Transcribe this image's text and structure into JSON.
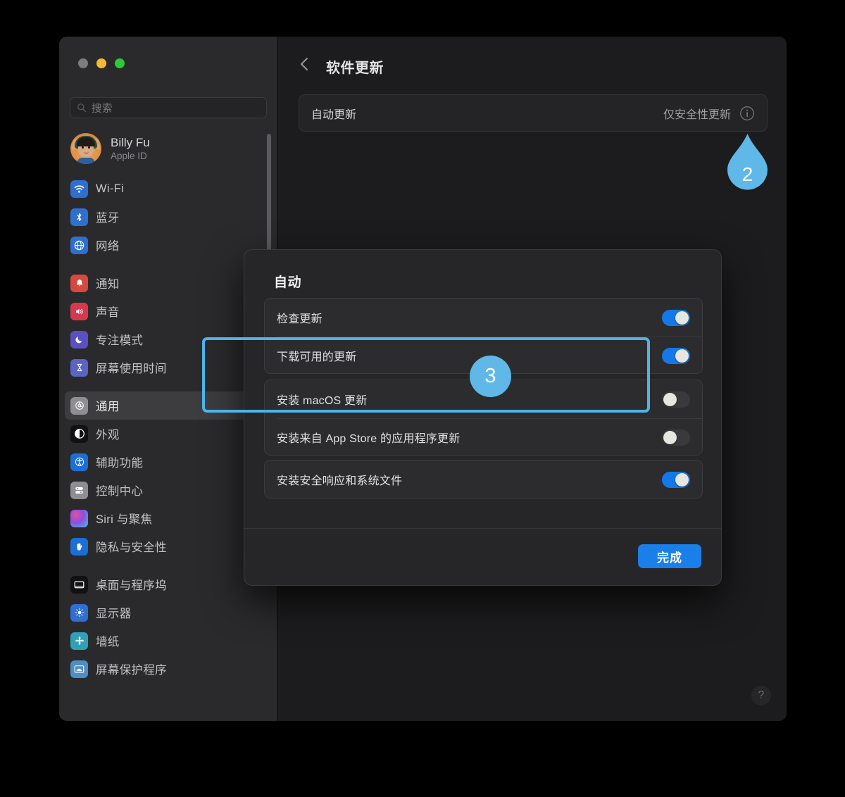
{
  "window": {
    "traffic_lights": [
      "close",
      "minimize",
      "maximize"
    ]
  },
  "sidebar": {
    "search": {
      "placeholder": "搜索",
      "icon": "search-icon"
    },
    "account": {
      "name": "Billy Fu",
      "subtitle": "Apple ID",
      "avatar": "memoji-avatar"
    },
    "groups": [
      {
        "items": [
          {
            "label": "Wi-Fi",
            "icon": "wifi-icon",
            "selected": false
          },
          {
            "label": "蓝牙",
            "icon": "bluetooth-icon",
            "selected": false
          },
          {
            "label": "网络",
            "icon": "network-icon",
            "selected": false
          }
        ]
      },
      {
        "items": [
          {
            "label": "通知",
            "icon": "bell-icon",
            "selected": false
          },
          {
            "label": "声音",
            "icon": "speaker-icon",
            "selected": false
          },
          {
            "label": "专注模式",
            "icon": "moon-icon",
            "selected": false
          },
          {
            "label": "屏幕使用时间",
            "icon": "hourglass-icon",
            "selected": false
          }
        ]
      },
      {
        "items": [
          {
            "label": "通用",
            "icon": "gear-icon",
            "selected": true
          },
          {
            "label": "外观",
            "icon": "appearance-icon",
            "selected": false
          },
          {
            "label": "辅助功能",
            "icon": "accessibility-icon",
            "selected": false
          },
          {
            "label": "控制中心",
            "icon": "control-center-icon",
            "selected": false
          },
          {
            "label": "Siri 与聚焦",
            "icon": "siri-icon",
            "selected": false
          },
          {
            "label": "隐私与安全性",
            "icon": "hand-privacy-icon",
            "selected": false
          }
        ]
      },
      {
        "items": [
          {
            "label": "桌面与程序坞",
            "icon": "desktop-dock-icon",
            "selected": false
          },
          {
            "label": "显示器",
            "icon": "display-icon",
            "selected": false
          },
          {
            "label": "墙纸",
            "icon": "wallpaper-icon",
            "selected": false
          },
          {
            "label": "屏幕保护程序",
            "icon": "screensaver-icon",
            "selected": false
          }
        ]
      }
    ]
  },
  "content": {
    "back_icon": "chevron-left-icon",
    "title": "软件更新",
    "auto_update_row": {
      "label": "自动更新",
      "value": "仅安全性更新",
      "info_icon": "info-circle-icon"
    },
    "help_button": {
      "label": "?",
      "icon": "help-icon"
    }
  },
  "sheet": {
    "title": "自动",
    "groups": [
      {
        "rows": [
          {
            "label": "检查更新",
            "switch": "on"
          },
          {
            "label": "下载可用的更新",
            "switch": "on"
          }
        ]
      },
      {
        "rows": [
          {
            "label": "安装 macOS 更新",
            "switch": "off"
          },
          {
            "label": "安装来自 App Store 的应用程序更新",
            "switch": "off"
          }
        ]
      },
      {
        "rows": [
          {
            "label": "安装安全响应和系统文件",
            "switch": "on"
          }
        ]
      }
    ],
    "done_button": "完成"
  },
  "annotations": {
    "marker_2": "2",
    "marker_3": "3",
    "highlight_color": "#4fb3e8",
    "marker_color": "#5fb8e8"
  },
  "colors": {
    "page_background": "#000000",
    "window_background": "#1e1e1e",
    "sidebar_background": "#2a2a2c",
    "content_background": "#1c1c1e",
    "sheet_background": "#262628",
    "accent_blue": "#1a7fe8",
    "switch_on": "#1478e8",
    "switch_off": "#3a3a3c"
  }
}
